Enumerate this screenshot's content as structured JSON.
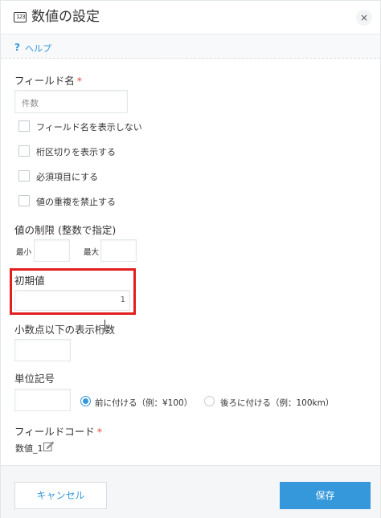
{
  "dialog": {
    "title": "数値の設定",
    "title_icon_text": "123",
    "close_symbol": "×"
  },
  "help": {
    "icon": "?",
    "label": "ヘルプ"
  },
  "field_name": {
    "label": "フィールド名",
    "required_mark": "*",
    "value": "件数"
  },
  "options": [
    {
      "label": "フィールド名を表示しない",
      "checked": false
    },
    {
      "label": "桁区切りを表示する",
      "checked": false
    },
    {
      "label": "必須項目にする",
      "checked": false
    },
    {
      "label": "値の重複を禁止する",
      "checked": false
    }
  ],
  "limit": {
    "label": "値の制限 (整数で指定)",
    "min_label": "最小",
    "max_label": "最大",
    "min_value": "",
    "max_value": ""
  },
  "default_value": {
    "label": "初期値",
    "value": "1"
  },
  "decimal": {
    "label": "小数点以下の表示桁数",
    "value": ""
  },
  "unit": {
    "label": "単位記号",
    "value": "",
    "position_options": [
      {
        "label": "前に付ける（例：¥100）",
        "selected": true
      },
      {
        "label": "後ろに付ける（例：100km）",
        "selected": false
      }
    ]
  },
  "field_code": {
    "label": "フィールドコード",
    "required_mark": "*",
    "value": "数値_1",
    "edit_icon": "pencil-edit-icon"
  },
  "footer": {
    "cancel_label": "キャンセル",
    "save_label": "保存"
  },
  "colors": {
    "accent": "#3498db",
    "required": "#e74c3c",
    "highlight": "#e11f1f"
  }
}
